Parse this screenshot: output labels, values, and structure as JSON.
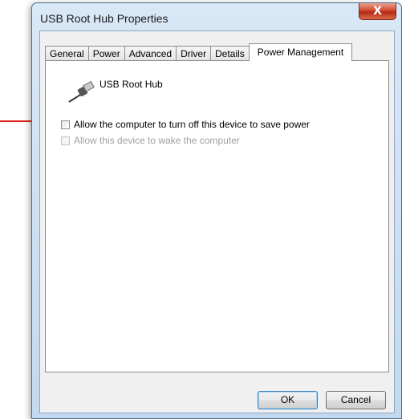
{
  "window": {
    "title": "USB Root Hub Properties",
    "close_label": "X"
  },
  "tabs": [
    "General",
    "Power",
    "Advanced",
    "Driver",
    "Details",
    "Power Management"
  ],
  "device": {
    "name": "USB Root Hub",
    "icon": "usb-plug-icon"
  },
  "options": [
    {
      "label": "Allow the computer to turn off this device to save power",
      "checked": false,
      "enabled": true
    },
    {
      "label": "Allow this device to wake the computer",
      "checked": false,
      "enabled": false
    }
  ],
  "buttons": {
    "ok": "OK",
    "cancel": "Cancel"
  },
  "colors": {
    "annotation_arrow": "#e0201a",
    "title_bar": "#c3d8ee",
    "close_button": "#c7422a"
  }
}
